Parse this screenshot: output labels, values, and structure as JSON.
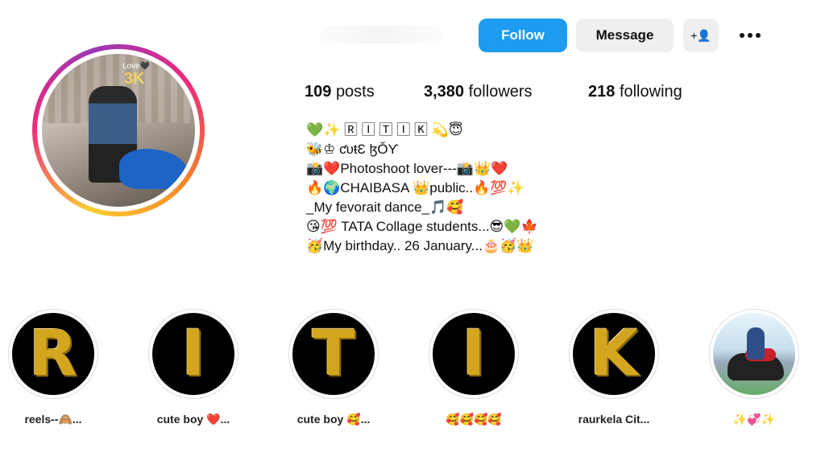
{
  "header": {
    "follow_label": "Follow",
    "message_label": "Message",
    "add_user_label": "+👤",
    "more_icon": "more-horizontal-icon"
  },
  "avatar": {
    "overlay_small": "Love🖤",
    "overlay_big": "3K"
  },
  "stats": {
    "posts_count": "109",
    "posts_label": "posts",
    "followers_count": "3,380",
    "followers_label": "followers",
    "following_count": "218",
    "following_label": "following"
  },
  "bio": [
    "💚✨ 🅁 🄸 🅃 🄸 🄺 💫😇",
    "🐝♔ ƈᴜŧƐ ɮŎƳ",
    "📸❤️Photoshoot lover---📸👑❤️",
    "🔥🌍CHAIBASA 👑public..🔥💯✨",
    "_My fevorait dance_🎵🥰",
    "😘💯 TATA Collage students...😎💚🍁",
    "🥳My birthday.. 26 January...🎂🥳👑"
  ],
  "highlights": [
    {
      "letter": "R",
      "label": "reels--🙈..."
    },
    {
      "letter": "I",
      "label": "cute boy ❤️..."
    },
    {
      "letter": "T",
      "label": "cute boy 🥰..."
    },
    {
      "letter": "I",
      "label": "🥰🥰🥰🥰"
    },
    {
      "letter": "K",
      "label": "raurkela Cit..."
    },
    {
      "letter": "",
      "label": "✨💞✨"
    }
  ],
  "colors": {
    "follow_blue": "#1d9bf0",
    "secondary_button": "#efefef",
    "letter_gold": "#d4a51e"
  }
}
